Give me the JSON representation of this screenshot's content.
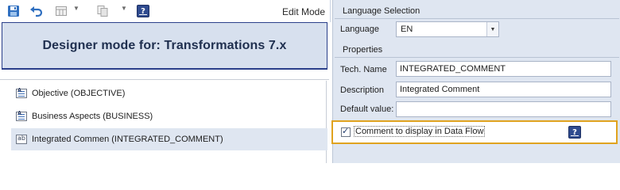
{
  "toolbar": {
    "mode_label": "Edit Mode",
    "icons": [
      "save-icon",
      "undo-icon",
      "grid-icon",
      "copy-icon",
      "help-icon"
    ],
    "help_glyph": "?"
  },
  "designer": {
    "title": "Designer mode for: Transformations 7.x"
  },
  "fields": [
    {
      "label": "Objective (OBJECTIVE)",
      "icon": "text-field-icon",
      "selected": false
    },
    {
      "label": "Business Aspects (BUSINESS)",
      "icon": "text-field-icon",
      "selected": false
    },
    {
      "label": "Integrated Commen (INTEGRATED_COMMENT)",
      "icon": "abc-field-icon",
      "selected": true
    }
  ],
  "language_section": {
    "header": "Language Selection",
    "language_label": "Language",
    "language_value": "EN"
  },
  "properties_section": {
    "header": "Properties",
    "tech_name_label": "Tech. Name",
    "tech_name_value": "INTEGRATED_COMMENT",
    "description_label": "Description",
    "description_value": "Integrated Comment",
    "default_label": "Default value:",
    "default_value": "",
    "checkbox_label": "Comment to display in Data Flow",
    "checkbox_checked": true,
    "help_glyph": "?"
  },
  "colors": {
    "accent_navy": "#2f4b8f",
    "panel_bg": "#dfe6f1",
    "highlight_border": "#e0a31f",
    "designer_bg": "#d7e0ee"
  }
}
